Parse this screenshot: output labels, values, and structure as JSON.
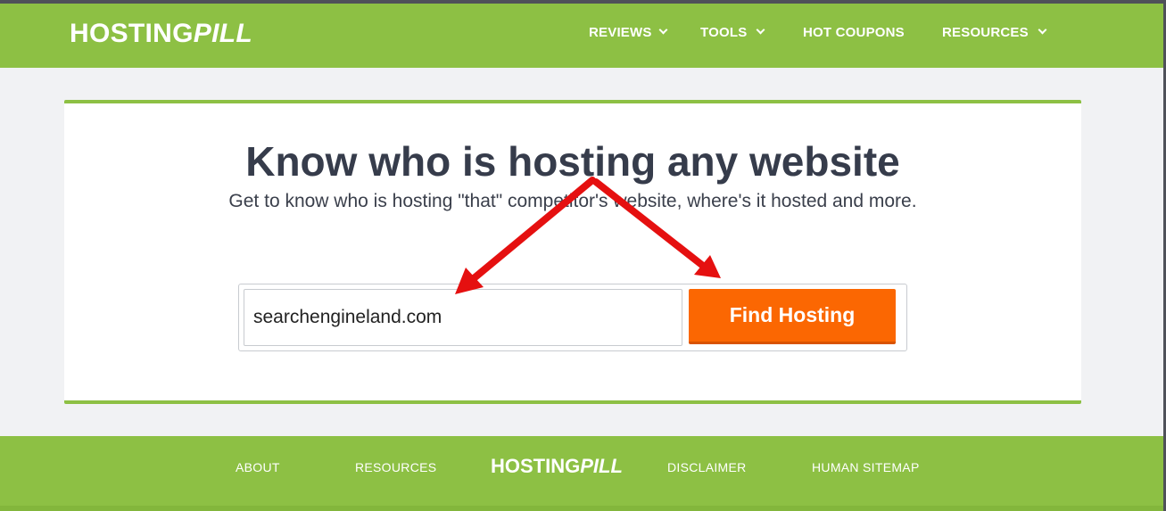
{
  "colors": {
    "brand_green": "#8dc044",
    "cta_orange": "#fb6702",
    "annotation_red": "#e51010",
    "heading_text": "#363c4b"
  },
  "header": {
    "logo": {
      "part1": "HOSTING",
      "part2": "PILL"
    },
    "nav": [
      {
        "label": "REVIEWS",
        "has_dropdown": true,
        "icon": "chevron-down-icon"
      },
      {
        "label": "TOOLS",
        "has_dropdown": true,
        "icon": "chevron-down-icon"
      },
      {
        "label": "HOT COUPONS",
        "has_dropdown": false
      },
      {
        "label": "RESOURCES",
        "has_dropdown": true,
        "icon": "chevron-down-icon"
      }
    ]
  },
  "main": {
    "headline": "Know who is hosting any website",
    "subline": "Get to know who is hosting \"that\" competitor's website, where's it hosted and more.",
    "search": {
      "value": "searchengineland.com",
      "button_label": "Find Hosting"
    }
  },
  "footer": {
    "links": [
      "ABOUT",
      "RESOURCES",
      "DISCLAIMER",
      "HUMAN SITEMAP"
    ],
    "logo": {
      "part1": "HOSTING",
      "part2": "PILL"
    }
  }
}
